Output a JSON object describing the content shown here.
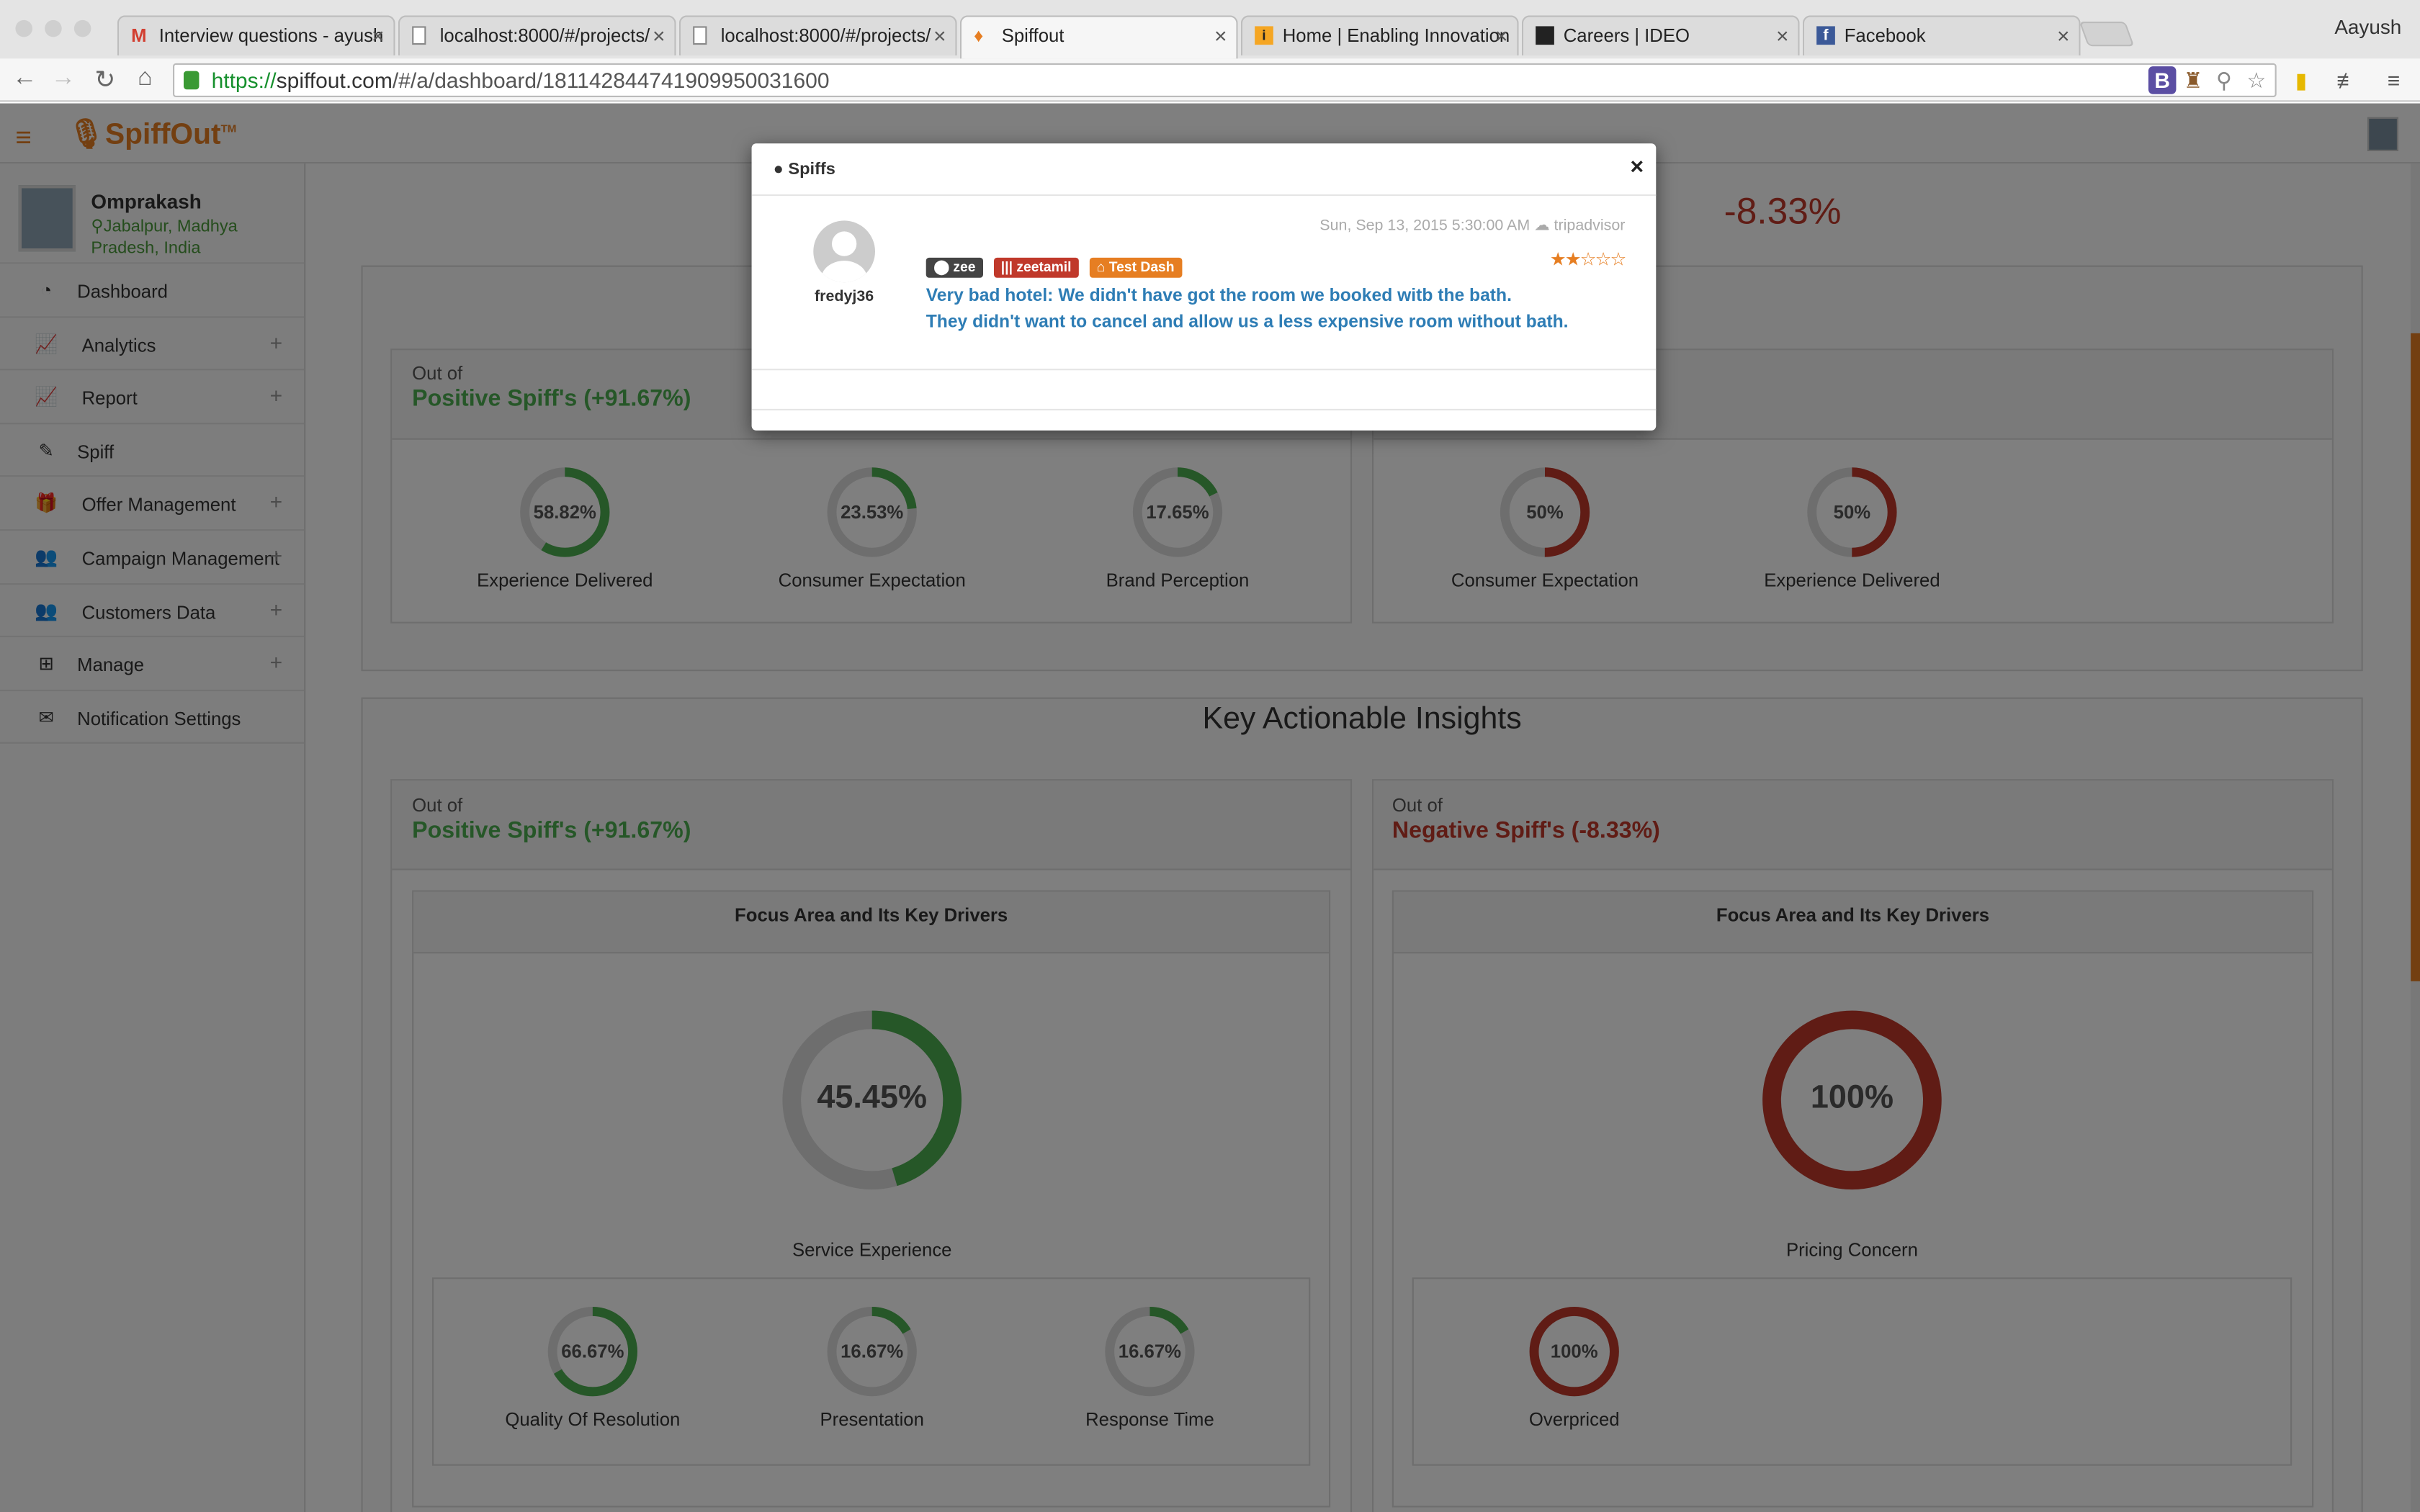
{
  "browser": {
    "user": "Aayush",
    "url_scheme": "https://",
    "url_host": "spiffout.com",
    "url_path": "/#/a/dashboard/181142844741909950031600",
    "tabs": [
      {
        "title": "Interview questions - ayush",
        "icon": "gmail-icon"
      },
      {
        "title": "localhost:8000/#/projects/",
        "icon": "page-icon"
      },
      {
        "title": "localhost:8000/#/projects/",
        "icon": "page-icon"
      },
      {
        "title": "Spiffout",
        "icon": "spiffout-icon"
      },
      {
        "title": "Home | Enabling Innovation",
        "icon": "ei-icon"
      },
      {
        "title": "Careers | IDEO",
        "icon": "ideo-icon"
      },
      {
        "title": "Facebook",
        "icon": "facebook-icon"
      }
    ]
  },
  "app": {
    "logo": "SpiffOut",
    "logo_tm": "TM",
    "profile": {
      "name": "Omprakash",
      "location": "Jabalpur, Madhya Pradesh, India"
    },
    "nav": [
      {
        "label": "Dashboard",
        "icon": "dashboard-icon",
        "expand": ""
      },
      {
        "label": "Analytics",
        "icon": "chart-icon",
        "expand": "+"
      },
      {
        "label": "Report",
        "icon": "chart-icon",
        "expand": "+"
      },
      {
        "label": "Spiff",
        "icon": "edit-icon",
        "expand": ""
      },
      {
        "label": "Offer Management",
        "icon": "gift-icon",
        "expand": "+"
      },
      {
        "label": "Campaign Management",
        "icon": "users-icon",
        "expand": "+"
      },
      {
        "label": "Customers Data",
        "icon": "users-icon",
        "expand": "+"
      },
      {
        "label": "Manage",
        "icon": "sitemap-icon",
        "expand": "+"
      },
      {
        "label": "Notification Settings",
        "icon": "envelope-icon",
        "expand": ""
      }
    ]
  },
  "dashboard": {
    "negative_score": "-8.33%",
    "top_positive": {
      "out_of": "Out of",
      "title": "Positive Spiff's (+91.67%)",
      "donuts": [
        {
          "value": "58.82%",
          "fraction": 0.5882,
          "label": "Experience Delivered"
        },
        {
          "value": "23.53%",
          "fraction": 0.2353,
          "label": "Consumer Expectation"
        },
        {
          "value": "17.65%",
          "fraction": 0.1765,
          "label": "Brand Perception"
        }
      ]
    },
    "top_negative": {
      "donuts": [
        {
          "value": "50%",
          "fraction": 0.5,
          "label": "Consumer Expectation"
        },
        {
          "value": "50%",
          "fraction": 0.5,
          "label": "Experience Delivered"
        }
      ]
    },
    "insights_title": "Key Actionable Insights",
    "insights_positive": {
      "out_of": "Out of",
      "title": "Positive Spiff's (+91.67%)",
      "focus_title": "Focus Area and Its Key Drivers",
      "main": {
        "value": "45.45%",
        "fraction": 0.4545,
        "label": "Service Experience"
      },
      "drivers": [
        {
          "value": "66.67%",
          "fraction": 0.6667,
          "label": "Quality Of Resolution"
        },
        {
          "value": "16.67%",
          "fraction": 0.1667,
          "label": "Presentation"
        },
        {
          "value": "16.67%",
          "fraction": 0.1667,
          "label": "Response Time"
        }
      ]
    },
    "insights_negative": {
      "out_of": "Out of",
      "title": "Negative Spiff's (-8.33%)",
      "focus_title": "Focus Area and Its Key Drivers",
      "main": {
        "value": "100%",
        "fraction": 1.0,
        "label": "Pricing Concern"
      },
      "drivers": [
        {
          "value": "100%",
          "fraction": 1.0,
          "label": "Overpriced"
        }
      ]
    },
    "colors": {
      "positive": "#4caf50",
      "negative": "#c0392b",
      "track": "#dddddd",
      "accent": "#e67e22"
    }
  },
  "modal": {
    "title": "Spiffs",
    "username": "fredyj36",
    "date": "Sun, Sep 13, 2015 5:30:00 AM",
    "source": "tripadvisor",
    "tags": [
      {
        "label": "zee",
        "color": "#444444",
        "icon": "tag-icon"
      },
      {
        "label": "zeetamil",
        "color": "#c0392b",
        "icon": "barcode-icon"
      },
      {
        "label": "Test Dash",
        "color": "#e67e22",
        "icon": "home-icon"
      }
    ],
    "rating": 2,
    "rating_max": 5,
    "review_line1": "Very bad hotel: We didn't have got the room we booked witb the bath.",
    "review_line2": "They didn't want to cancel and allow us a less expensive room without bath.",
    "close": "×"
  }
}
